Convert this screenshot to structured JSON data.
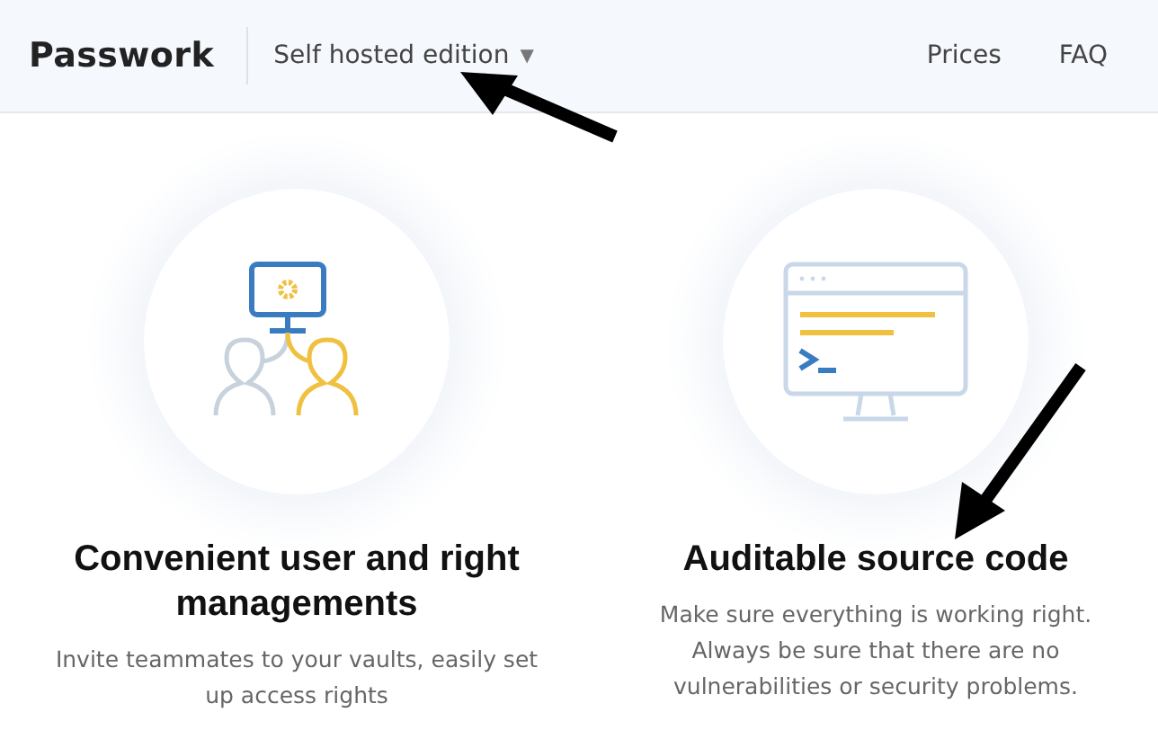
{
  "header": {
    "logo": "Passwork",
    "edition": {
      "label": "Self hosted edition",
      "caret": "▼"
    },
    "nav": [
      {
        "label": "Prices"
      },
      {
        "label": "FAQ"
      }
    ]
  },
  "features": [
    {
      "kind": "users",
      "title": "Convenient user and right managements",
      "description": "Invite teammates to your vaults, easily set up access rights"
    },
    {
      "kind": "code",
      "title": "Auditable source code",
      "description": "Make sure everything is working right. Always be sure that there are no vulnerabilities or security problems."
    }
  ],
  "annotation_arrows": [
    {
      "kind": "upleft"
    },
    {
      "kind": "downleft"
    }
  ]
}
